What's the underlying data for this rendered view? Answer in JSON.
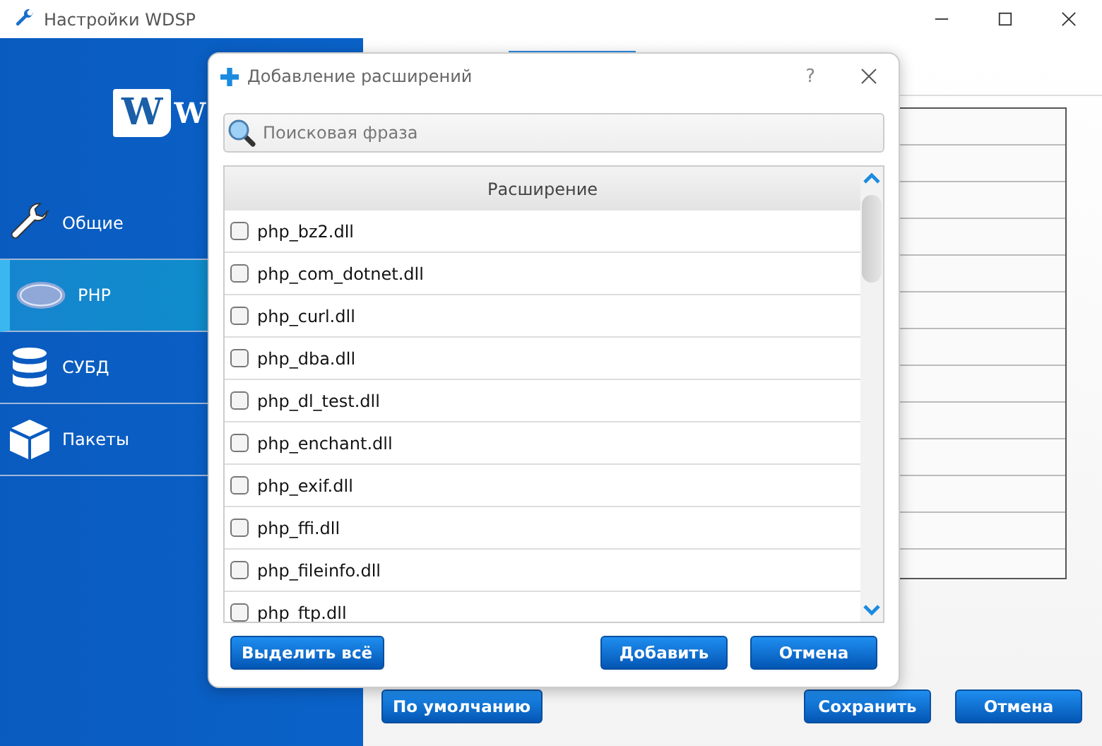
{
  "window": {
    "title": "Настройки WDSP"
  },
  "logo": {
    "badge": "W",
    "text": "W"
  },
  "sidebar": {
    "items": [
      {
        "label": "Общие",
        "kind": "wrench",
        "selected": false
      },
      {
        "label": "PHP",
        "kind": "php",
        "selected": true
      },
      {
        "label": "СУБД",
        "kind": "database",
        "selected": false
      },
      {
        "label": "Пакеты",
        "kind": "box",
        "selected": false
      }
    ]
  },
  "main": {
    "buttons": {
      "default": "По умолчанию",
      "save": "Сохранить",
      "cancel": "Отмена"
    }
  },
  "dialog": {
    "title": "Добавление расширений",
    "help": "?",
    "search": {
      "placeholder": "Поисковая фраза"
    },
    "column": "Расширение",
    "rows": [
      {
        "name": "php_bz2.dll",
        "checked": false
      },
      {
        "name": "php_com_dotnet.dll",
        "checked": false
      },
      {
        "name": "php_curl.dll",
        "checked": false
      },
      {
        "name": "php_dba.dll",
        "checked": false
      },
      {
        "name": "php_dl_test.dll",
        "checked": false
      },
      {
        "name": "php_enchant.dll",
        "checked": false
      },
      {
        "name": "php_exif.dll",
        "checked": false
      },
      {
        "name": "php_ffi.dll",
        "checked": false
      },
      {
        "name": "php_fileinfo.dll",
        "checked": false
      },
      {
        "name": "php_ftp.dll",
        "checked": false
      }
    ],
    "buttons": {
      "select_all": "Выделить всё",
      "add": "Добавить",
      "cancel": "Отмена"
    }
  }
}
